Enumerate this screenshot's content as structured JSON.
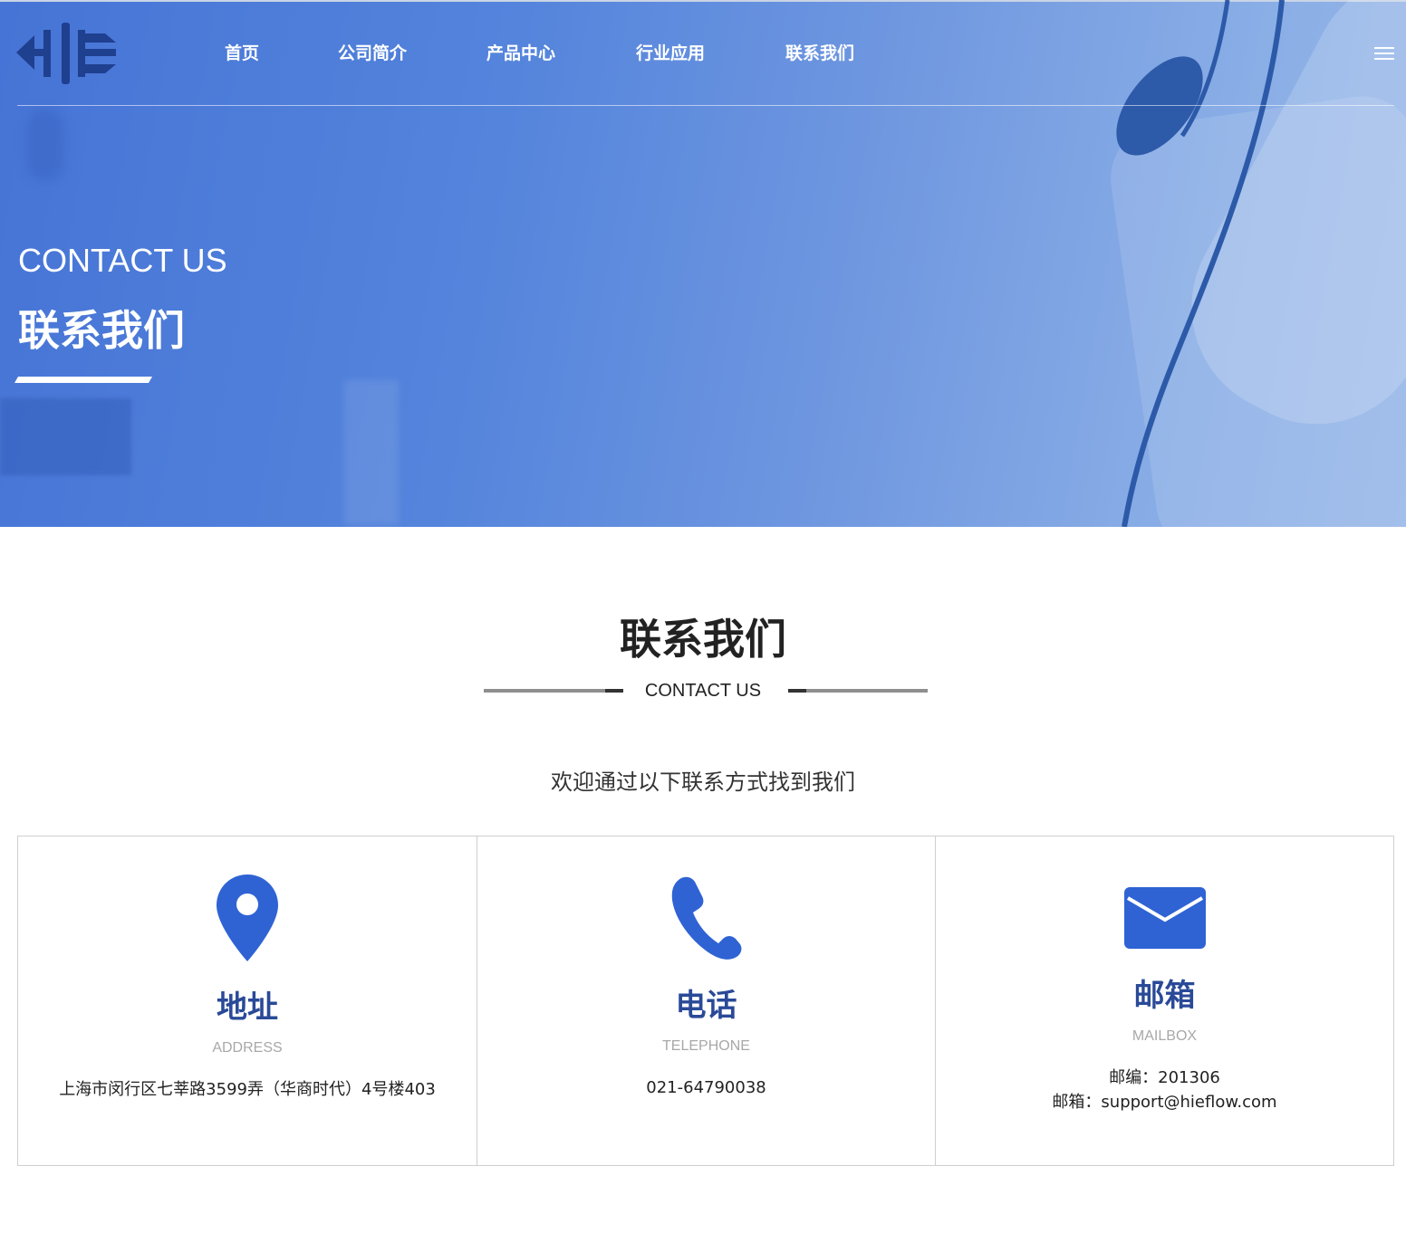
{
  "header": {
    "logo_icon": "hie-logo-icon",
    "nav": [
      "首页",
      "公司简介",
      "产品中心",
      "行业应用",
      "联系我们"
    ],
    "menu_icon": "hamburger-menu-icon"
  },
  "hero": {
    "title_en": "CONTACT US",
    "title_cn": "联系我们"
  },
  "section": {
    "title": "联系我们",
    "subtitle": "CONTACT US",
    "description": "欢迎通过以下联系方式找到我们"
  },
  "cards": [
    {
      "icon": "location-pin-icon",
      "title": "地址",
      "subtitle": "ADDRESS",
      "lines": [
        "上海市闵行区七莘路3599弄（华商时代）4号楼403"
      ]
    },
    {
      "icon": "phone-icon",
      "title": "电话",
      "subtitle": "TELEPHONE",
      "lines": [
        "021-64790038"
      ]
    },
    {
      "icon": "mail-icon",
      "title": "邮箱",
      "subtitle": "MAILBOX",
      "lines": [
        "邮编：201306",
        "邮箱：support@hieflow.com"
      ]
    }
  ],
  "colors": {
    "hero_blue": "#4674d6",
    "accent_blue": "#2f63d4",
    "title_blue": "#2a4a98",
    "logo_navy": "#1f3f8f"
  }
}
